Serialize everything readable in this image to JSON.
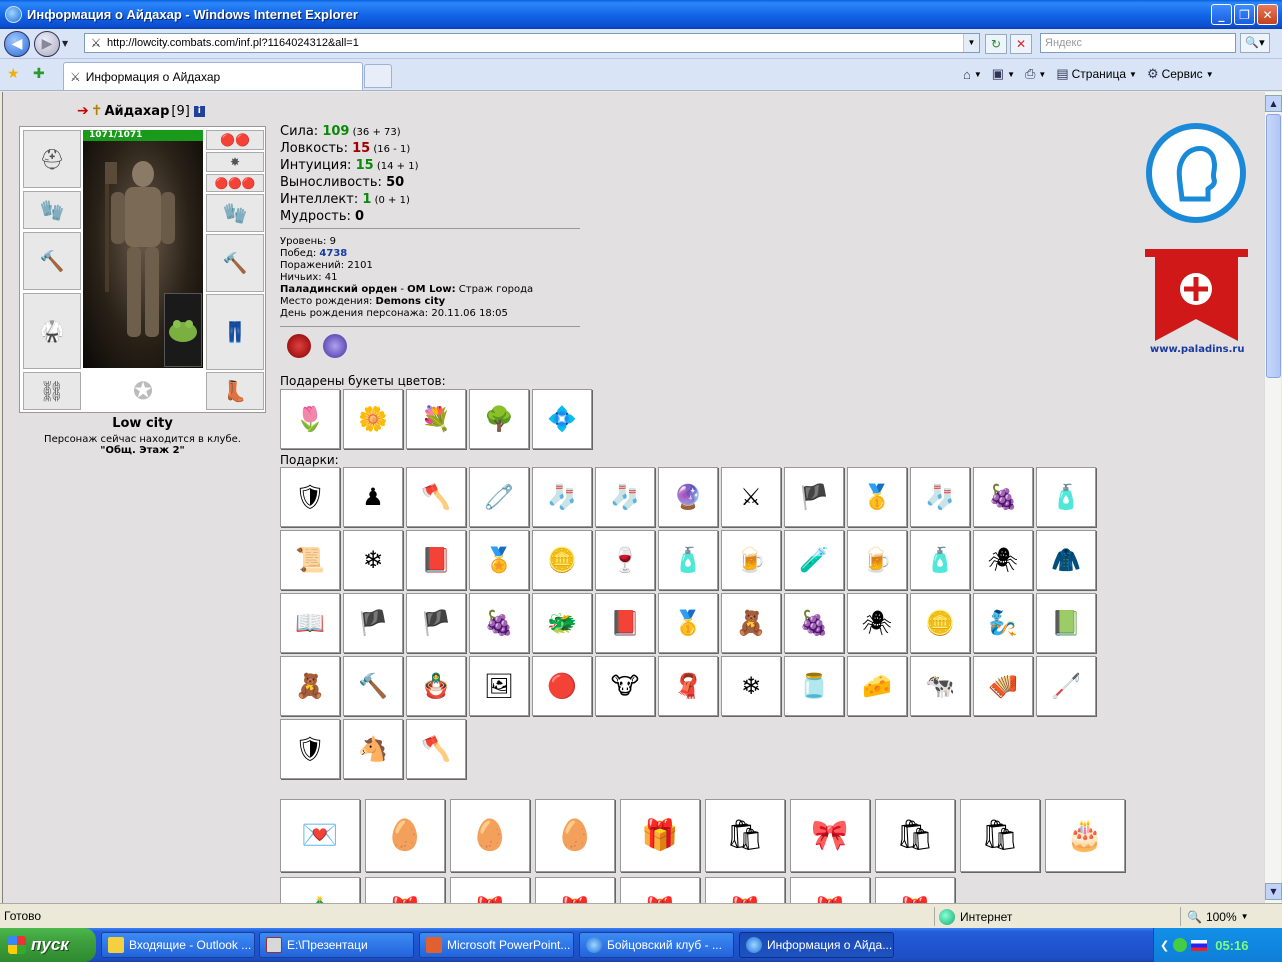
{
  "window": {
    "title": "Информация о Айдахар - Windows Internet Explorer"
  },
  "address": {
    "url": "http://lowcity.combats.com/inf.pl?1164024312&all=1",
    "search_placeholder": "Яндекс"
  },
  "tab": {
    "label": "Информация о Айдахар"
  },
  "commands": {
    "page": "Страница",
    "tools": "Сервис"
  },
  "character": {
    "name": "Айдахар",
    "level": "[9]",
    "hp": "1071/1071",
    "city": "Low city",
    "location_text": "Персонаж сейчас находится в клубе.",
    "room": "\"Общ. Этаж 2\""
  },
  "stats": [
    {
      "label": "Сила: ",
      "value": "109",
      "detail": " (36 + 73)",
      "color": "g"
    },
    {
      "label": "Ловкость: ",
      "value": "15",
      "detail": " (16 - 1)",
      "color": "r"
    },
    {
      "label": "Интуиция: ",
      "value": "15",
      "detail": " (14 + 1)",
      "color": "g"
    },
    {
      "label": "Выносливость: ",
      "value": "50",
      "detail": "",
      "color": ""
    },
    {
      "label": "Интеллект: ",
      "value": "1",
      "detail": " (0 + 1)",
      "color": "g"
    },
    {
      "label": "Мудрость: ",
      "value": "0",
      "detail": "",
      "color": ""
    }
  ],
  "info": {
    "level_label": "Уровень: ",
    "level": "9",
    "wins_label": "Побед: ",
    "wins": "4738",
    "losses_label": "Поражений: ",
    "losses": "2101",
    "draws_label": "Ничьих: ",
    "draws": "41",
    "order": "Паладинский орден",
    "order_sep": " - ",
    "order_rank": "OM Low:",
    "order_title": " Страж города",
    "birthplace_label": "Место рождения: ",
    "birthplace": "Demons city",
    "birthday_label": "День рождения персонажа: ",
    "birthday": "20.11.06 18:05"
  },
  "labels": {
    "flowers": "Подарены букеты цветов:",
    "gifts": "Подарки:"
  },
  "flowers": [
    "🌷",
    "🌼",
    "💐",
    "🌳",
    "💠"
  ],
  "gifts": [
    "🛡",
    "♟",
    "🪓",
    "🧷",
    "🧦",
    "🧦",
    "🔮",
    "⚔",
    "🏴",
    "🥇",
    "🧦",
    "🍇",
    "🧴",
    "📜",
    "❄",
    "📕",
    "🏅",
    "🪙",
    "🍷",
    "🧴",
    "🍺",
    "🧪",
    "🍺",
    "🧴",
    "🕷",
    "🧥",
    "📖",
    "🏴",
    "🏴",
    "🍇",
    "🐲",
    "📕",
    "🥇",
    "🧸",
    "🍇",
    "🕷",
    "🪙",
    "🧞",
    "📗",
    "🧸",
    "🔨",
    "🪆",
    "🖼",
    "🔴",
    "🐮",
    "🧣",
    "❄",
    "🫙",
    "🧀",
    "🐄",
    "🪗",
    "🦯",
    "🛡",
    "🐴",
    "🪓"
  ],
  "big_gifts": [
    "💌",
    "🥚",
    "🥚",
    "🥚",
    "🎁",
    "🛍",
    "🎀",
    "🛍",
    "🛍",
    "🎂",
    "🎄",
    "🎁",
    "🎁",
    "🎁",
    "🎁",
    "🎁",
    "🎁",
    "🎁"
  ],
  "paladin": {
    "url_text": "www.paladins.ru"
  },
  "status": {
    "ready": "Готово",
    "zone": "Интернет",
    "zoom": "100%"
  },
  "taskbar": {
    "start": "пуск",
    "tasks": [
      "Входящие - Outlook ...",
      "E:\\Презентаци",
      "Microsoft PowerPoint...",
      "Бойцовский клуб - ...",
      "Информация о Айда..."
    ],
    "clock": "05:16"
  },
  "colors": {
    "titlebar": "#1466E8",
    "wins_blue": "#1A3AA0",
    "stat_green": "#0A8A0A",
    "stat_red": "#A00000"
  }
}
